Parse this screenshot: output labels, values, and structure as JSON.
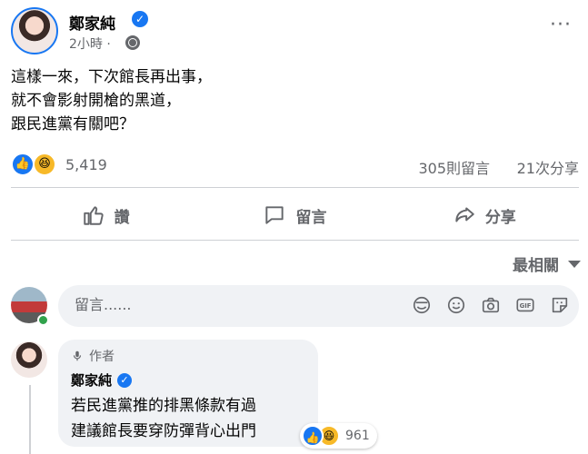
{
  "post": {
    "author": "鄭家純",
    "time": "2小時",
    "time_sep": "·",
    "more": "···",
    "lines": [
      "這樣一來，下次館長再出事，",
      "就不會影射開槍的黑道，",
      "跟民進黨有關吧？"
    ]
  },
  "stats": {
    "reactions": "5,419",
    "comments": "305則留言",
    "shares": "21次分享"
  },
  "actions": {
    "like": "讚",
    "comment": "留言",
    "share": "分享"
  },
  "sort": {
    "label": "最相關"
  },
  "composer": {
    "placeholder": "留言......",
    "gif": "GIF"
  },
  "comment": {
    "badge": "作者",
    "author": "鄭家純",
    "lines": [
      "若民進黨推的排黑條款有過",
      "建議館長要穿防彈背心出門"
    ],
    "reactions": "961"
  },
  "colors": {
    "accent": "#1877f2",
    "secondary_text": "#65676b",
    "bubble_bg": "#f0f2f5",
    "haha": "#f7b928",
    "online": "#31a24c"
  },
  "icons": [
    "verified-icon",
    "globe-icon",
    "more-icon",
    "like-icon",
    "haha-icon",
    "comment-icon",
    "share-icon",
    "caret-down-icon",
    "sticker-icon",
    "emoji-icon",
    "camera-icon",
    "gif-icon",
    "avatar-sticker-icon",
    "mic-icon"
  ]
}
